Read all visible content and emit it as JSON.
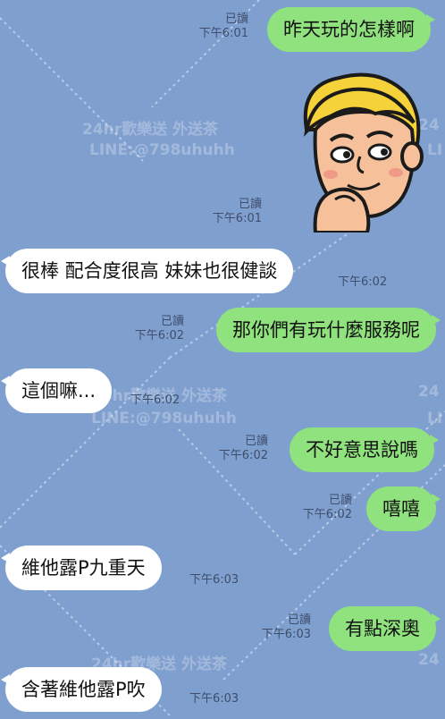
{
  "watermark": {
    "line1": "24hr歡樂送 外送茶",
    "line2": "LINE:@798uhuhh",
    "edge1": "24",
    "edge2": "LI"
  },
  "messages": [
    {
      "id": "m1",
      "side": "out",
      "text": "昨天玩的怎樣啊",
      "read": "已讀",
      "time": "下午6:01"
    },
    {
      "id": "m2",
      "side": "out",
      "sticker": "blond-cartoon-face-sticker",
      "read": "已讀",
      "time": "下午6:01"
    },
    {
      "id": "m3",
      "side": "in",
      "text": "很棒 配合度很高  妹妹也很健談",
      "time": "下午6:02"
    },
    {
      "id": "m4",
      "side": "out",
      "text": "那你們有玩什麼服務呢",
      "read": "已讀",
      "time": "下午6:02"
    },
    {
      "id": "m5",
      "side": "in",
      "text": "這個嘛...",
      "time": "下午6:02"
    },
    {
      "id": "m6",
      "side": "out",
      "text": "不好意思說嗎",
      "read": "已讀",
      "time": "下午6:02"
    },
    {
      "id": "m7",
      "side": "out",
      "text": "嘻嘻",
      "read": "已讀",
      "time": "下午6:02"
    },
    {
      "id": "m8",
      "side": "in",
      "text": "維他露P九重天",
      "time": "下午6:03"
    },
    {
      "id": "m9",
      "side": "out",
      "text": "有點深奧",
      "read": "已讀",
      "time": "下午6:03"
    },
    {
      "id": "m10",
      "side": "in",
      "text": "含著維他露P吹",
      "time": "下午6:03"
    }
  ],
  "colors": {
    "background": "#7f9fcf",
    "outgoing_bubble": "#8fe27d",
    "incoming_bubble": "#ffffff"
  }
}
